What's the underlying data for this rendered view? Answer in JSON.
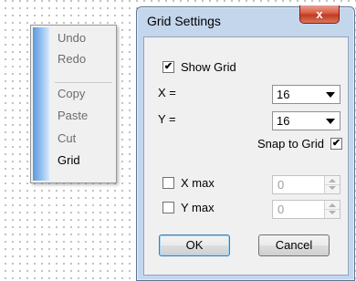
{
  "context_menu": {
    "items": [
      {
        "label": "Undo",
        "enabled": false
      },
      {
        "label": "Redo",
        "enabled": false
      },
      {
        "label": "Copy",
        "enabled": false
      },
      {
        "label": "Paste",
        "enabled": false
      },
      {
        "label": "Cut",
        "enabled": false
      },
      {
        "label": "Grid",
        "enabled": true
      }
    ]
  },
  "dialog": {
    "title": "Grid Settings",
    "close_label": "x",
    "show_grid": {
      "label": "Show Grid",
      "checked": true
    },
    "x": {
      "label": "X =",
      "value": "16"
    },
    "y": {
      "label": "Y =",
      "value": "16"
    },
    "snap_to_grid": {
      "label": "Snap to Grid",
      "checked": true
    },
    "x_max": {
      "label": "X max",
      "checked": false,
      "value": "0"
    },
    "y_max": {
      "label": "Y max",
      "checked": false,
      "value": "0"
    },
    "ok_label": "OK",
    "cancel_label": "Cancel",
    "check_mark": "✔"
  },
  "colors": {
    "dialog_frame": "#c4d6ec",
    "close_button": "#d75a41",
    "menu_gutter": "#5c9ad8"
  }
}
